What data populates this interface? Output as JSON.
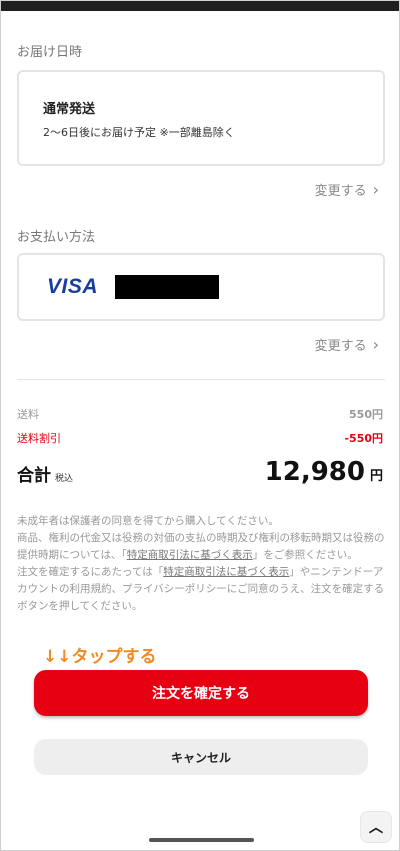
{
  "delivery": {
    "section_title": "お届け日時",
    "method_name": "通常発送",
    "method_desc": "2〜6日後にお届け予定 ※一部離島除く",
    "change_label": "変更する"
  },
  "payment": {
    "section_title": "お支払い方法",
    "card_brand": "VISA",
    "change_label": "変更する"
  },
  "summary": {
    "shipping_label": "送料",
    "shipping_value": "550円",
    "discount_label": "送料割引",
    "discount_value": "-550円",
    "total_label": "合計",
    "tax_label": "税込",
    "total_value": "12,980",
    "currency": "円"
  },
  "notes": {
    "line1": "未成年者は保護者の同意を得てから購入してください。",
    "line2_a": "商品、権利の代金又は役務の対価の支払の時期及び権利の移転時期又は役務の提供時期については、「",
    "line2_link": "特定商取引法に基づく表示",
    "line2_b": "」をご参照ください。",
    "line3_a": "注文を確定するにあたっては「",
    "line3_link": "特定商取引法に基づく表示",
    "line3_b": "」やニンテンドーアカウントの利用規約、プライバシーポリシーにご同意のうえ、注文を確定するボタンを押してください。"
  },
  "tap_hint": "↓↓タップする",
  "buttons": {
    "confirm_label": "注文を確定する",
    "cancel_label": "キャンセル"
  },
  "icons": {
    "chevron": "chevron-right-icon",
    "scroll_top": "chevron-up-icon"
  },
  "colors": {
    "accent": "#e60012",
    "hint": "#f08a24",
    "visa": "#1a3f9b"
  }
}
